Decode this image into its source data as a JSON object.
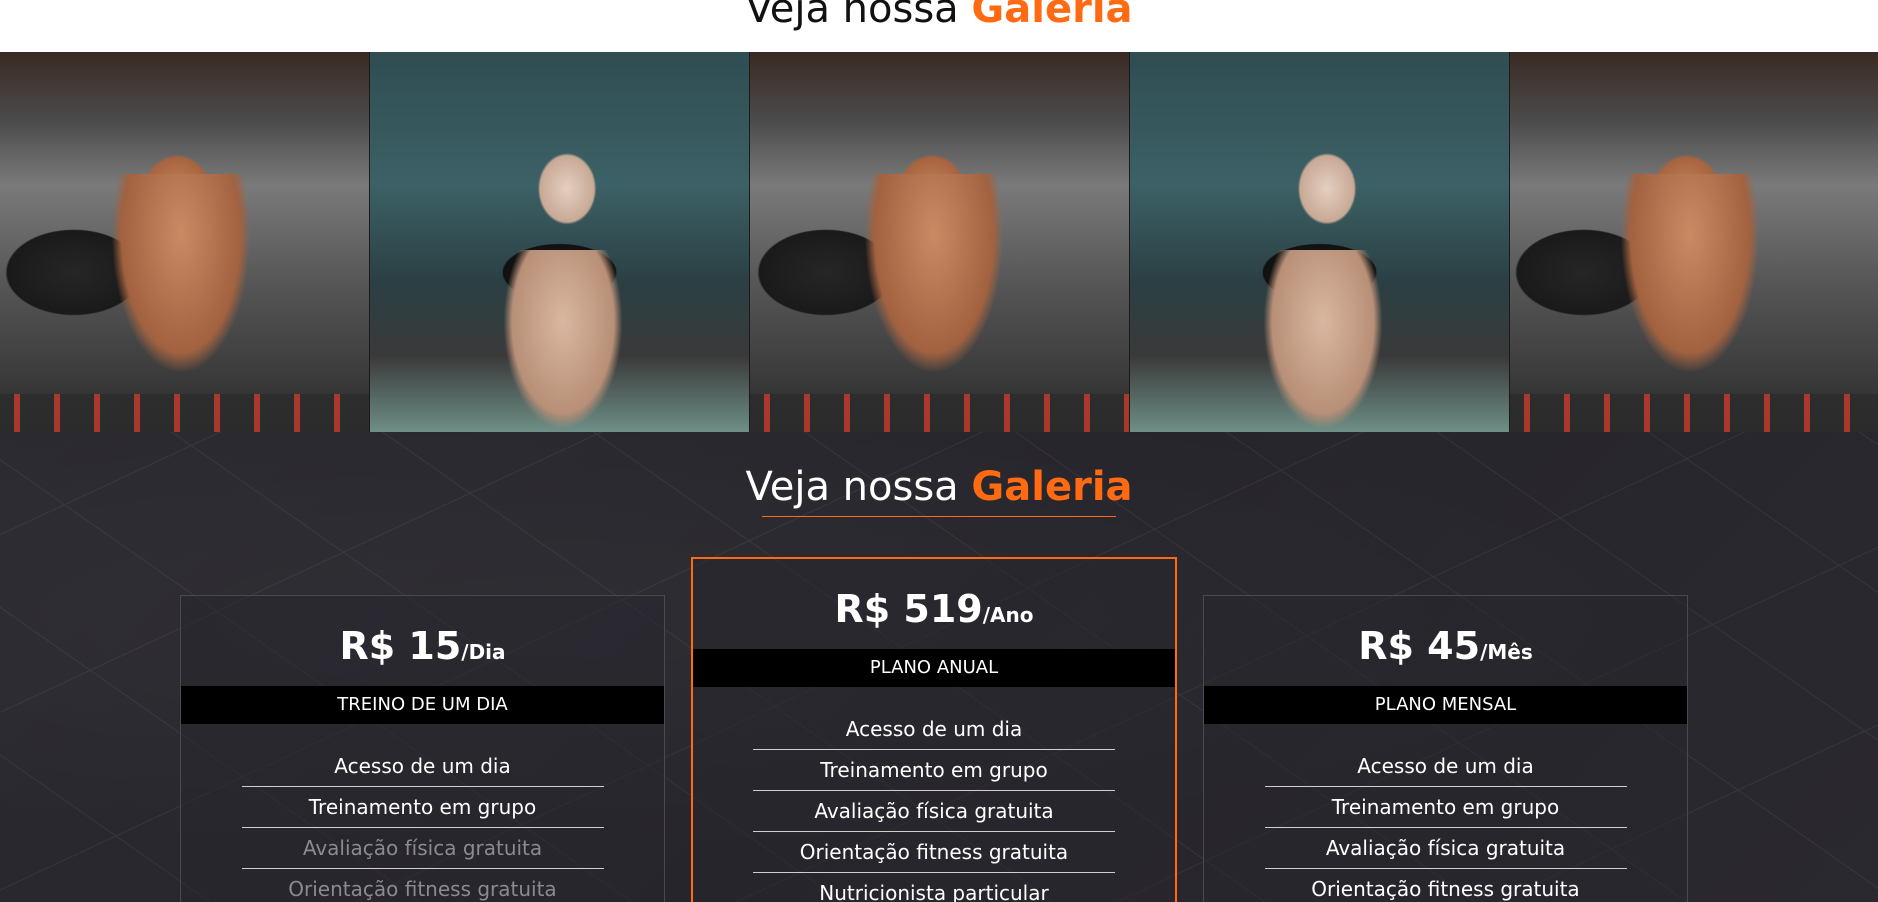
{
  "top_header": {
    "title_prefix": "Veja nossa",
    "title_accent": "Galeria"
  },
  "gallery": {
    "images": [
      {
        "alt": "Homem levantando barra",
        "kind": "man"
      },
      {
        "alt": "Mulher fazendo abdominal",
        "kind": "woman"
      },
      {
        "alt": "Homem levantando barra",
        "kind": "man"
      },
      {
        "alt": "Mulher fazendo abdominal",
        "kind": "woman"
      },
      {
        "alt": "Homem levantando barra",
        "kind": "man"
      }
    ]
  },
  "pricing": {
    "title_prefix": "Veja nossa",
    "title_accent": "Galeria",
    "accent_color": "#ff6a13",
    "plans": [
      {
        "price": "R$ 15",
        "period": "/Dia",
        "name": "TREINO DE UM DIA",
        "features": [
          {
            "label": "Acesso de um dia",
            "included": true
          },
          {
            "label": "Treinamento em grupo",
            "included": true
          },
          {
            "label": "Avaliação física gratuita",
            "included": false
          },
          {
            "label": "Orientação fitness gratuita",
            "included": false
          }
        ]
      },
      {
        "price": "R$ 519",
        "period": "/Ano",
        "name": "PLANO ANUAL",
        "features": [
          {
            "label": "Acesso de um dia",
            "included": true
          },
          {
            "label": "Treinamento em grupo",
            "included": true
          },
          {
            "label": "Avaliação física gratuita",
            "included": true
          },
          {
            "label": "Orientação fitness gratuita",
            "included": true
          },
          {
            "label": "Nutricionista particular",
            "included": true
          }
        ]
      },
      {
        "price": "R$ 45",
        "period": "/Mês",
        "name": "PLANO MENSAL",
        "features": [
          {
            "label": "Acesso de um dia",
            "included": true
          },
          {
            "label": "Treinamento em grupo",
            "included": true
          },
          {
            "label": "Avaliação física gratuita",
            "included": true
          },
          {
            "label": "Orientação fitness gratuita",
            "included": true
          }
        ]
      }
    ]
  }
}
